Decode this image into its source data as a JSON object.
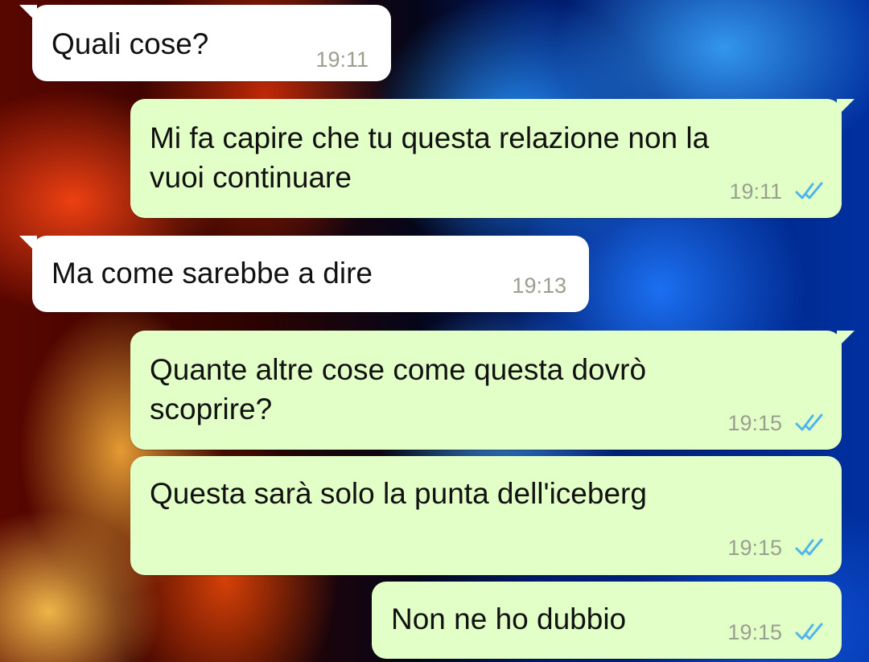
{
  "chat": {
    "messages": [
      {
        "direction": "incoming",
        "text": "Quali cose?",
        "time": "19:11"
      },
      {
        "direction": "outgoing",
        "text": "Mi fa capire che tu questa relazione non la\nvuoi continuare",
        "time": "19:11",
        "status": "read"
      },
      {
        "direction": "incoming",
        "text": "Ma come sarebbe a dire",
        "time": "19:13"
      },
      {
        "direction": "outgoing",
        "text": "Quante altre cose come questa dovrò\nscoprire?",
        "time": "19:15",
        "status": "read"
      },
      {
        "direction": "outgoing",
        "text": "Questa sarà solo la punta dell'iceberg",
        "time": "19:15",
        "status": "read"
      },
      {
        "direction": "outgoing",
        "text": "Non ne ho dubbio",
        "time": "19:15",
        "status": "read"
      }
    ]
  },
  "colors": {
    "incoming_bubble": "#ffffff",
    "outgoing_bubble": "#e2ffc7",
    "read_ticks": "#4fb6ec",
    "timestamp": "#9aa090"
  },
  "icons": {
    "read_receipt": "double-check-icon",
    "wallpaper": "fire-and-ice-wallpaper"
  }
}
